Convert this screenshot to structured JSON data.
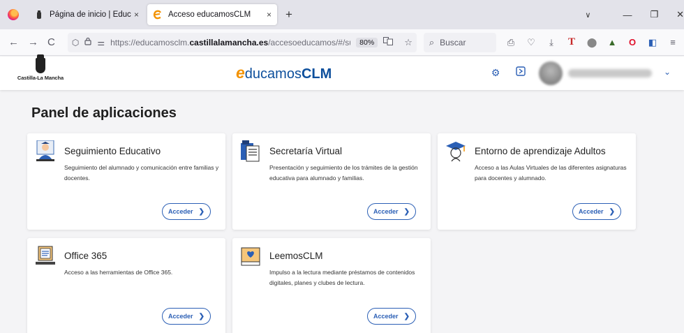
{
  "browser": {
    "tabs": [
      {
        "title": "Página de inicio | EducamosCLM",
        "active": false,
        "close": "×"
      },
      {
        "title": "Acceso educamosCLM",
        "active": true,
        "close": "×"
      }
    ],
    "new_tab": "+",
    "window": {
      "tabs_list": "∨",
      "minimize": "—",
      "restore": "❐",
      "close": "✕"
    },
    "nav": {
      "back": "←",
      "forward": "→",
      "reload": "C"
    },
    "url_prefix": "https://educamosclm.",
    "url_domain": "castillalamancha.es",
    "url_path": "/accesoeducamos/#/su",
    "zoom": "80%",
    "search_placeholder": "Buscar"
  },
  "header": {
    "org_label": "Castilla-La Mancha",
    "brand_e": "e",
    "brand_word": "ducamos",
    "brand_clm": "CLM"
  },
  "page_title": "Panel de aplicaciones",
  "cards": [
    {
      "title": "Seguimiento Educativo",
      "description": "Seguimiento del alumnado y comunicación entre familias y docentes.",
      "button": "Acceder",
      "icon": "teacher-icon"
    },
    {
      "title": "Secretaría Virtual",
      "description": "Presentación y seguimiento de los trámites de la gestión educativa para alumnado y familias.",
      "button": "Acceder",
      "icon": "documents-icon"
    },
    {
      "title": "Entorno de aprendizaje Adultos",
      "description": "Acceso a las Aulas Virtuales de las diferentes asignaturas para docentes y alumnado.",
      "button": "Acceder",
      "icon": "graduate-icon"
    },
    {
      "title": "Office 365",
      "description": "Acceso a las herramientas de Office 365.",
      "button": "Acceder",
      "icon": "laptop-icon"
    },
    {
      "title": "LeemosCLM",
      "description": "Impulso a la lectura mediante préstamos de contenidos digitales, planes y clubes de lectura.",
      "button": "Acceder",
      "icon": "book-heart-icon"
    }
  ],
  "colors": {
    "accent": "#2b5fb5",
    "brand_orange": "#f39200",
    "brand_blue": "#0d4f9c"
  }
}
